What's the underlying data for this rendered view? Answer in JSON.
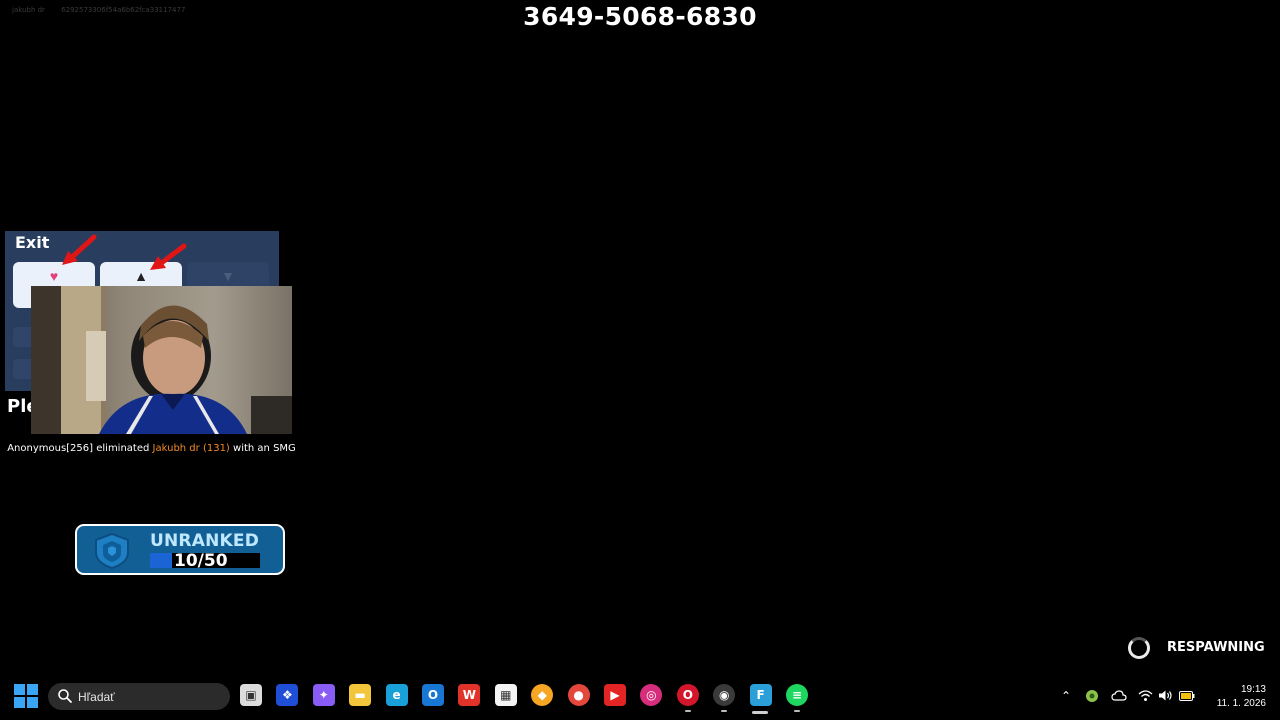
{
  "watermark": {
    "username": "jakubh dr",
    "session_id": "6292573306f54a6b62fca33117477"
  },
  "map_code": "3649-5068-6830",
  "exit_panel": {
    "title": "Exit",
    "heart_icon": "heart-icon",
    "like_icon": "thumbs-up-icon",
    "dislike_icon": "thumbs-down-icon",
    "partial_text": "Ple"
  },
  "webcam": {
    "description_icon": "webcam-overlay"
  },
  "kill_feed": {
    "killer": "Anonymous[256]",
    "verb": "eliminated",
    "victim": "Jakubh dr (131)",
    "suffix": "with an SMG"
  },
  "rank": {
    "label": "UNRANKED",
    "progress_text": "10/50",
    "progress_fraction": 0.2,
    "colors": {
      "badge": "#125f95",
      "fill": "#1a64d6",
      "label": "#bfe8ff"
    }
  },
  "respawn": {
    "label": "RESPAWNING"
  },
  "taskbar": {
    "search_placeholder": "Hľadať",
    "apps": [
      {
        "name": "task-view-icon",
        "color": "#dcdcdc"
      },
      {
        "name": "dropbox-icon",
        "color": "#1f4fd6"
      },
      {
        "name": "copilot-icon",
        "color": "#8a5cf6"
      },
      {
        "name": "file-explorer-icon",
        "color": "#f3c53a"
      },
      {
        "name": "edge-icon",
        "color": "#1aa0d8"
      },
      {
        "name": "outlook-icon",
        "color": "#1877d2"
      },
      {
        "name": "wps-office-icon",
        "color": "#e2332b"
      },
      {
        "name": "microsoft-store-icon",
        "color": "#f4f4f4"
      },
      {
        "name": "brave-icon",
        "color": "#f6a623"
      },
      {
        "name": "chrome-icon",
        "color": "#e4473b"
      },
      {
        "name": "youtube-icon",
        "color": "#e32424"
      },
      {
        "name": "instagram-icon",
        "color": "#d62e7c"
      },
      {
        "name": "opera-gx-icon",
        "color": "#d4162d"
      },
      {
        "name": "obs-icon",
        "color": "#3a3a3a"
      },
      {
        "name": "fortnite-icon",
        "color": "#2a9fd8"
      },
      {
        "name": "spotify-icon",
        "color": "#1ed760"
      }
    ],
    "tray": {
      "chevron_icon": "chevron-up-icon",
      "wifi_icon": "wifi-icon",
      "volume_icon": "volume-icon",
      "battery_icon": "battery-icon"
    },
    "time": "19:13",
    "date": "11. 1. 2026"
  }
}
